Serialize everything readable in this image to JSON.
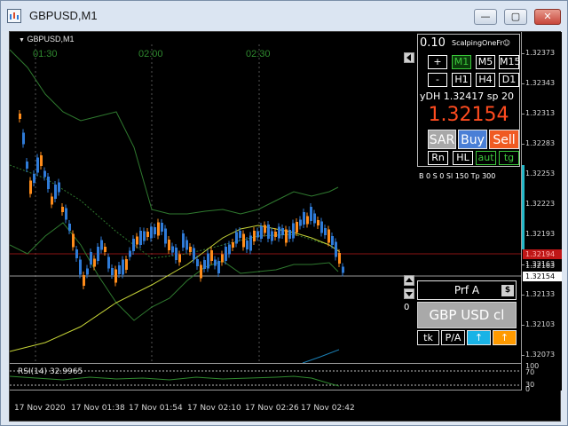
{
  "window": {
    "title": "GBPUSD,M1",
    "controls": [
      "minimize",
      "maximize",
      "close"
    ]
  },
  "chart": {
    "symbol_label": "GBPUSD,M1",
    "time_markers": [
      "01:30",
      "02:00",
      "02:30"
    ],
    "price_axis": [
      "1.32373",
      "1.32343",
      "1.32313",
      "1.32283",
      "1.32253",
      "1.32223",
      "1.32193",
      "1.32163",
      "1.32133",
      "1.32103",
      "1.32073"
    ],
    "price_highlights": {
      "ask": "1.32194",
      "line": "1.32163",
      "bid": "1.32154",
      "ask_color": "#c01616",
      "bid_color": "#ffffff"
    },
    "time_axis": [
      "17 Nov 2020",
      "17 Nov 01:38",
      "17 Nov 01:54",
      "17 Nov 02:10",
      "17 Nov 02:26",
      "17 Nov 02:42"
    ],
    "rsi": {
      "label": "RSI(14) 32.9965",
      "levels": [
        "100",
        "70",
        "30",
        "0"
      ]
    },
    "colors": {
      "bull_candle": "#2f7bd8",
      "bear_candle": "#ff8c1a",
      "bands": "#2f8a2f",
      "ma": "#d8e63a"
    }
  },
  "ea_panel": {
    "lots": "0.10",
    "name": "ScalpingOneFr",
    "smiley_icon": "smiley-icon",
    "buttons_row1": [
      "+",
      "M1",
      "M5",
      "M15"
    ],
    "buttons_row2": [
      "-",
      "H1",
      "H4",
      "D1"
    ],
    "active_timeframe": "M1",
    "ydh_text": "yDH 1.32417",
    "spread_text": "sp 20",
    "price": "1.32154",
    "sar_label": "SAR",
    "buy_label": "Buy",
    "sell_label": "Sell",
    "small_buttons": [
      "Rn",
      "HL",
      "aut",
      "tg"
    ],
    "info": "B 0   S 0 Sl 150 Tp 300"
  },
  "profit_panel": {
    "prf_label": "Prf A",
    "dollar_icon": "$",
    "profit_value": "0",
    "symbol_button": "GBP USD cl",
    "buttons": [
      "tk",
      "P/A"
    ]
  }
}
